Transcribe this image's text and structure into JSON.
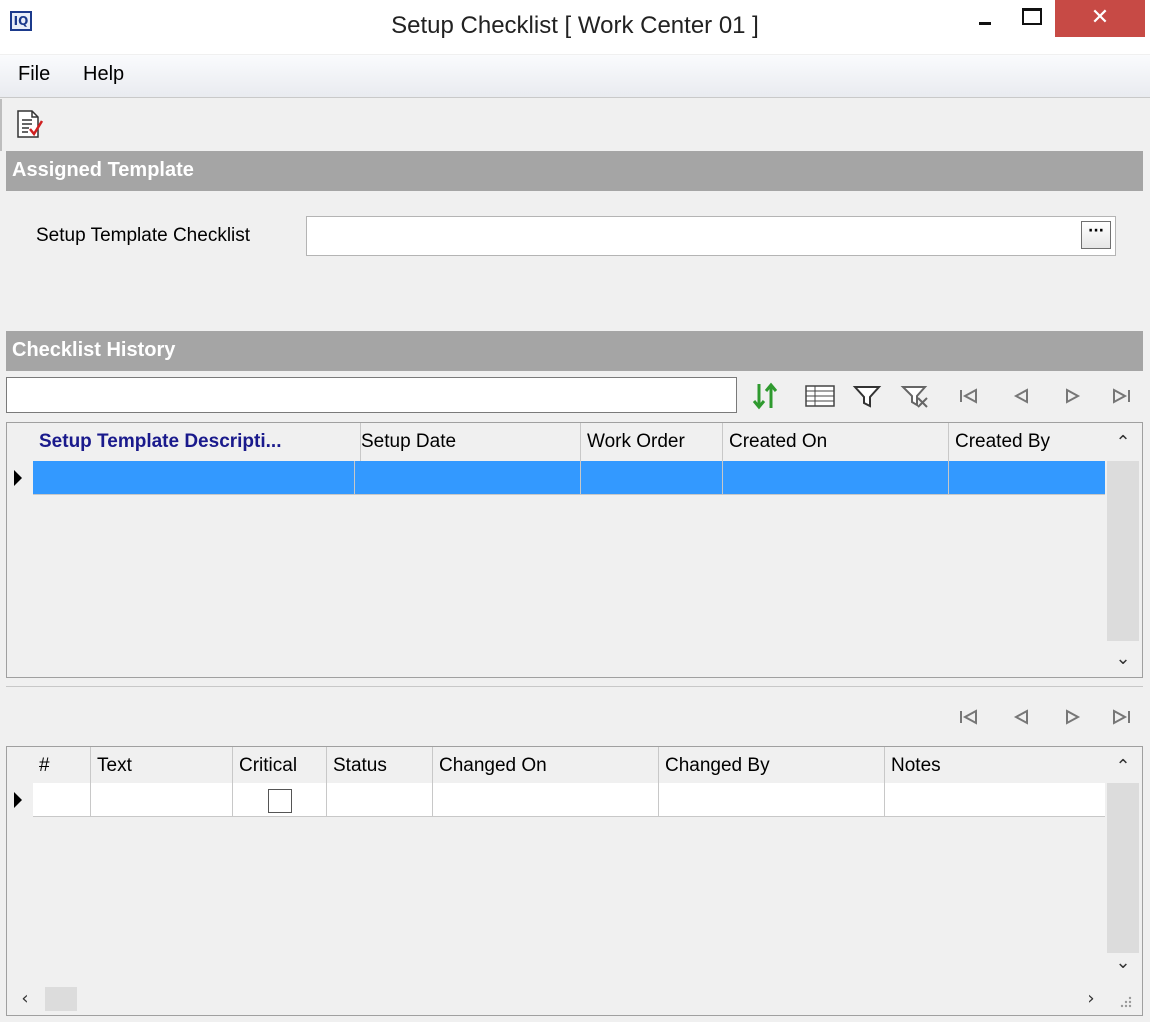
{
  "window": {
    "app_logo": "IQ",
    "title": "Setup Checklist [ Work Center 01 ]",
    "close_glyph": "✕"
  },
  "menu": {
    "file_label": "File",
    "help_label": "Help"
  },
  "assigned_template": {
    "header": "Assigned Template",
    "field_label": "Setup Template Checklist",
    "field_value": "",
    "lookup_glyph": "···"
  },
  "checklist_history": {
    "header": "Checklist History",
    "search_value": "",
    "columns": [
      "Setup Template Descripti...",
      "Setup Date",
      "Work Order",
      "Created On",
      "Created By"
    ],
    "rows": [
      {
        "selected": true,
        "cells": [
          "",
          "",
          "",
          "",
          ""
        ]
      }
    ]
  },
  "checklist_items": {
    "columns": [
      "#",
      "Text",
      "Critical",
      "Status",
      "Changed On",
      "Changed By",
      "Notes"
    ],
    "rows": [
      {
        "cells": [
          "",
          "",
          "",
          "",
          "",
          "",
          ""
        ],
        "critical_checked": false
      }
    ]
  },
  "icons": {
    "toolbar": "checklist-edit-icon",
    "history_toolbar": [
      "sort-icon",
      "grid-layout-icon",
      "filter-icon",
      "clear-filter-icon",
      "first-record-icon",
      "previous-record-icon",
      "next-record-icon",
      "last-record-icon"
    ]
  },
  "colors": {
    "selected_row": "#3399ff",
    "section_header": "#a5a5a5",
    "close_button": "#c74a45",
    "link_header": "#1a1a8c"
  }
}
